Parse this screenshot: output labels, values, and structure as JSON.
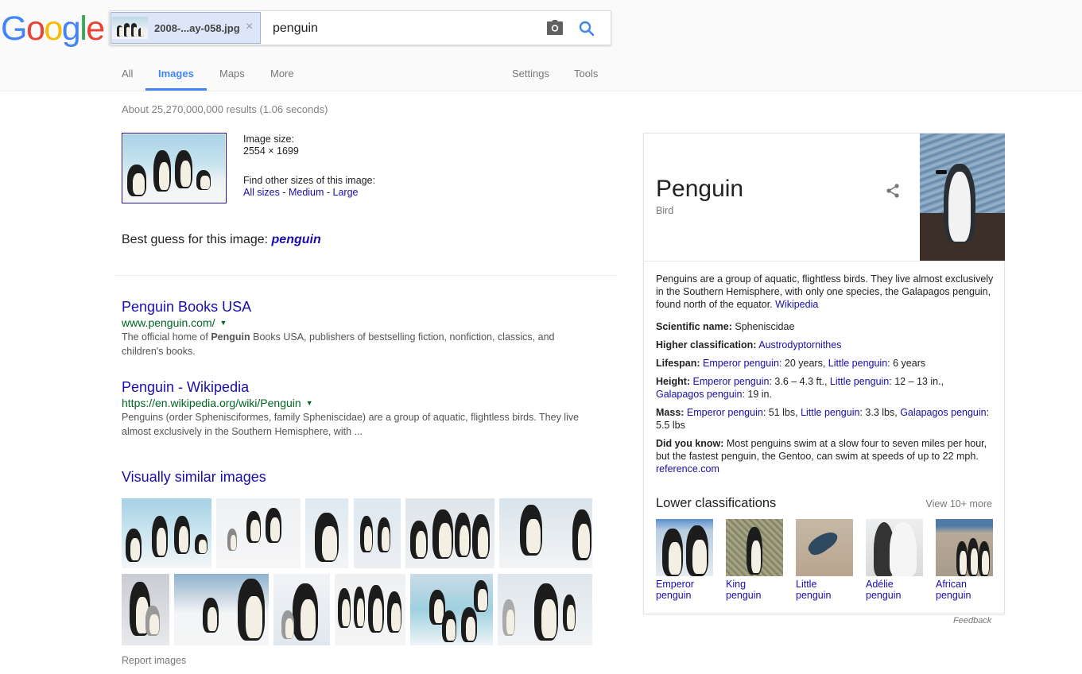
{
  "header": {
    "logo_letters": [
      {
        "char": "G",
        "color": "#4285f4"
      },
      {
        "char": "o",
        "color": "#ea4335"
      },
      {
        "char": "o",
        "color": "#fbbc05"
      },
      {
        "char": "g",
        "color": "#4285f4"
      },
      {
        "char": "l",
        "color": "#34a853"
      },
      {
        "char": "e",
        "color": "#ea4335"
      }
    ],
    "search": {
      "image_chip_name": "2008-...ay-058.jpg",
      "image_chip_close": "×",
      "query_value": "penguin",
      "camera_icon": "camera-icon",
      "search_icon": "search-icon"
    },
    "tabs": [
      {
        "label": "All",
        "active": false
      },
      {
        "label": "Images",
        "active": true
      },
      {
        "label": "Maps",
        "active": false
      },
      {
        "label": "More",
        "active": false
      }
    ],
    "right_tabs": [
      {
        "label": "Settings"
      },
      {
        "label": "Tools"
      }
    ],
    "accent_color": "#4285f4"
  },
  "results": {
    "stats": "About 25,270,000,000 results (1.06 seconds)",
    "image_size_label": "Image size:",
    "image_size_value": "2554 × 1699",
    "other_sizes_label": "Find other sizes of this image:",
    "size_links": [
      "All sizes",
      "Medium",
      "Large"
    ],
    "size_separator": " - ",
    "best_guess_label": "Best guess for this image: ",
    "best_guess_value": "penguin",
    "items": [
      {
        "title": "Penguin Books USA",
        "url": "www.penguin.com/",
        "snippet_before": "The official home of ",
        "snippet_bold": "Penguin",
        "snippet_after": " Books USA, publishers of bestselling fiction, nonfiction, classics, and children's books."
      },
      {
        "title": "Penguin - Wikipedia",
        "url": "https://en.wikipedia.org/wiki/Penguin",
        "snippet_before": "Penguins (order Sphenisciformes, family Spheniscidae) are a group of aquatic, flightless birds. They live almost exclusively in the Southern Hemisphere, with ...",
        "snippet_bold": "",
        "snippet_after": ""
      }
    ],
    "similar_title": "Visually similar images",
    "similar_images_count": 12,
    "report_label": "Report images"
  },
  "knowledge_panel": {
    "title": "Penguin",
    "subtitle": "Bird",
    "share_icon": "share-icon",
    "description": "Penguins are a group of aquatic, flightless birds. They live almost exclusively in the Southern Hemisphere, with only one species, the Galapagos penguin, found north of the equator. ",
    "description_source": "Wikipedia",
    "facts": {
      "scientific_name_label": "Scientific name:",
      "scientific_name": "Spheniscidae",
      "higher_class_label": "Higher classification:",
      "higher_class": "Austrodyptornithes",
      "lifespan_label": "Lifespan:",
      "lifespan": [
        {
          "link": "Emperor penguin",
          "value": ": 20 years, "
        },
        {
          "link": "Little penguin",
          "value": ": 6 years"
        }
      ],
      "height_label": "Height:",
      "height": [
        {
          "link": "Emperor penguin",
          "value": ": 3.6 – 4.3 ft., "
        },
        {
          "link": "Little penguin",
          "value": ": 12 – 13 in., "
        },
        {
          "link": "Galapagos penguin",
          "value": ": 19 in."
        }
      ],
      "mass_label": "Mass:",
      "mass": [
        {
          "link": "Emperor penguin",
          "value": ": 51 lbs, "
        },
        {
          "link": "Little penguin",
          "value": ": 3.3 lbs, "
        },
        {
          "link": "Galapagos penguin",
          "value": ": 5.5 lbs"
        }
      ],
      "did_you_know_label": "Did you know:",
      "did_you_know": " Most penguins swim at a slow four to seven miles per hour, but the fastest penguin, the Gentoo, can swim at speeds of up to 22 mph. ",
      "did_you_know_source": "reference.com"
    },
    "lower_title": "Lower classifications",
    "view_more": "View 10+ more",
    "lower_items": [
      {
        "line1": "Emperor",
        "line2": "penguin"
      },
      {
        "line1": "King",
        "line2": "penguin"
      },
      {
        "line1": "Little",
        "line2": "penguin"
      },
      {
        "line1": "Adélie",
        "line2": "penguin"
      },
      {
        "line1": "African",
        "line2": "penguin"
      }
    ],
    "feedback": "Feedback"
  }
}
